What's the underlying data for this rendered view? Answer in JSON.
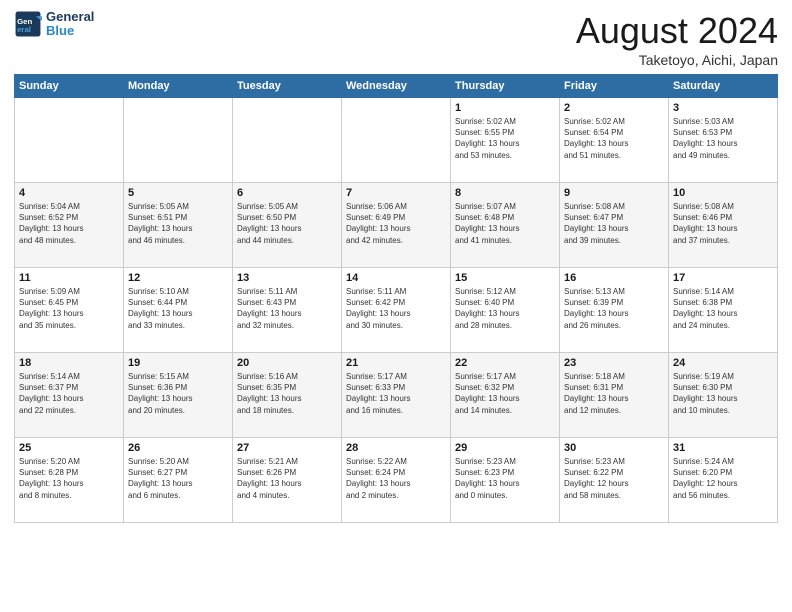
{
  "header": {
    "logo_line1": "General",
    "logo_line2": "Blue",
    "month": "August 2024",
    "location": "Taketoyo, Aichi, Japan"
  },
  "weekdays": [
    "Sunday",
    "Monday",
    "Tuesday",
    "Wednesday",
    "Thursday",
    "Friday",
    "Saturday"
  ],
  "weeks": [
    [
      {
        "day": "",
        "info": ""
      },
      {
        "day": "",
        "info": ""
      },
      {
        "day": "",
        "info": ""
      },
      {
        "day": "",
        "info": ""
      },
      {
        "day": "1",
        "info": "Sunrise: 5:02 AM\nSunset: 6:55 PM\nDaylight: 13 hours\nand 53 minutes."
      },
      {
        "day": "2",
        "info": "Sunrise: 5:02 AM\nSunset: 6:54 PM\nDaylight: 13 hours\nand 51 minutes."
      },
      {
        "day": "3",
        "info": "Sunrise: 5:03 AM\nSunset: 6:53 PM\nDaylight: 13 hours\nand 49 minutes."
      }
    ],
    [
      {
        "day": "4",
        "info": "Sunrise: 5:04 AM\nSunset: 6:52 PM\nDaylight: 13 hours\nand 48 minutes."
      },
      {
        "day": "5",
        "info": "Sunrise: 5:05 AM\nSunset: 6:51 PM\nDaylight: 13 hours\nand 46 minutes."
      },
      {
        "day": "6",
        "info": "Sunrise: 5:05 AM\nSunset: 6:50 PM\nDaylight: 13 hours\nand 44 minutes."
      },
      {
        "day": "7",
        "info": "Sunrise: 5:06 AM\nSunset: 6:49 PM\nDaylight: 13 hours\nand 42 minutes."
      },
      {
        "day": "8",
        "info": "Sunrise: 5:07 AM\nSunset: 6:48 PM\nDaylight: 13 hours\nand 41 minutes."
      },
      {
        "day": "9",
        "info": "Sunrise: 5:08 AM\nSunset: 6:47 PM\nDaylight: 13 hours\nand 39 minutes."
      },
      {
        "day": "10",
        "info": "Sunrise: 5:08 AM\nSunset: 6:46 PM\nDaylight: 13 hours\nand 37 minutes."
      }
    ],
    [
      {
        "day": "11",
        "info": "Sunrise: 5:09 AM\nSunset: 6:45 PM\nDaylight: 13 hours\nand 35 minutes."
      },
      {
        "day": "12",
        "info": "Sunrise: 5:10 AM\nSunset: 6:44 PM\nDaylight: 13 hours\nand 33 minutes."
      },
      {
        "day": "13",
        "info": "Sunrise: 5:11 AM\nSunset: 6:43 PM\nDaylight: 13 hours\nand 32 minutes."
      },
      {
        "day": "14",
        "info": "Sunrise: 5:11 AM\nSunset: 6:42 PM\nDaylight: 13 hours\nand 30 minutes."
      },
      {
        "day": "15",
        "info": "Sunrise: 5:12 AM\nSunset: 6:40 PM\nDaylight: 13 hours\nand 28 minutes."
      },
      {
        "day": "16",
        "info": "Sunrise: 5:13 AM\nSunset: 6:39 PM\nDaylight: 13 hours\nand 26 minutes."
      },
      {
        "day": "17",
        "info": "Sunrise: 5:14 AM\nSunset: 6:38 PM\nDaylight: 13 hours\nand 24 minutes."
      }
    ],
    [
      {
        "day": "18",
        "info": "Sunrise: 5:14 AM\nSunset: 6:37 PM\nDaylight: 13 hours\nand 22 minutes."
      },
      {
        "day": "19",
        "info": "Sunrise: 5:15 AM\nSunset: 6:36 PM\nDaylight: 13 hours\nand 20 minutes."
      },
      {
        "day": "20",
        "info": "Sunrise: 5:16 AM\nSunset: 6:35 PM\nDaylight: 13 hours\nand 18 minutes."
      },
      {
        "day": "21",
        "info": "Sunrise: 5:17 AM\nSunset: 6:33 PM\nDaylight: 13 hours\nand 16 minutes."
      },
      {
        "day": "22",
        "info": "Sunrise: 5:17 AM\nSunset: 6:32 PM\nDaylight: 13 hours\nand 14 minutes."
      },
      {
        "day": "23",
        "info": "Sunrise: 5:18 AM\nSunset: 6:31 PM\nDaylight: 13 hours\nand 12 minutes."
      },
      {
        "day": "24",
        "info": "Sunrise: 5:19 AM\nSunset: 6:30 PM\nDaylight: 13 hours\nand 10 minutes."
      }
    ],
    [
      {
        "day": "25",
        "info": "Sunrise: 5:20 AM\nSunset: 6:28 PM\nDaylight: 13 hours\nand 8 minutes."
      },
      {
        "day": "26",
        "info": "Sunrise: 5:20 AM\nSunset: 6:27 PM\nDaylight: 13 hours\nand 6 minutes."
      },
      {
        "day": "27",
        "info": "Sunrise: 5:21 AM\nSunset: 6:26 PM\nDaylight: 13 hours\nand 4 minutes."
      },
      {
        "day": "28",
        "info": "Sunrise: 5:22 AM\nSunset: 6:24 PM\nDaylight: 13 hours\nand 2 minutes."
      },
      {
        "day": "29",
        "info": "Sunrise: 5:23 AM\nSunset: 6:23 PM\nDaylight: 13 hours\nand 0 minutes."
      },
      {
        "day": "30",
        "info": "Sunrise: 5:23 AM\nSunset: 6:22 PM\nDaylight: 12 hours\nand 58 minutes."
      },
      {
        "day": "31",
        "info": "Sunrise: 5:24 AM\nSunset: 6:20 PM\nDaylight: 12 hours\nand 56 minutes."
      }
    ]
  ]
}
